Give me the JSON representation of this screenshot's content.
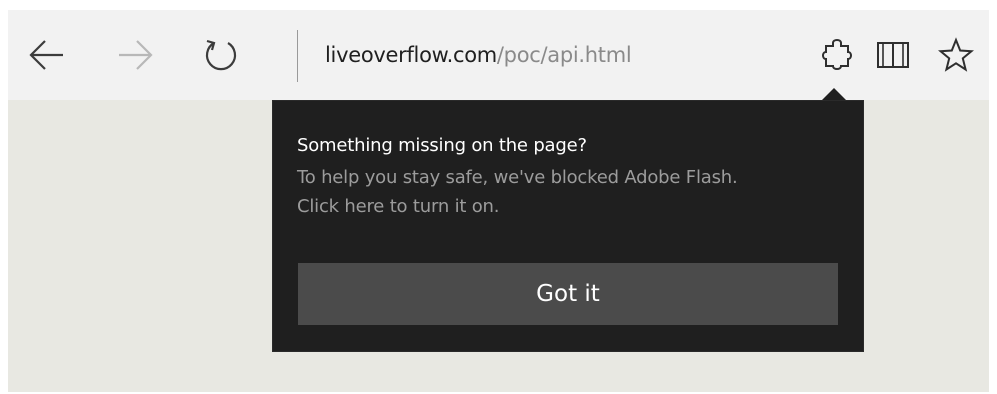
{
  "browser": {
    "nav": {
      "back_icon": "arrow-left-icon",
      "forward_icon": "arrow-right-icon",
      "refresh_icon": "refresh-icon"
    },
    "address": {
      "host": "liveoverflow.com",
      "path": "/poc/api.html"
    },
    "actions": {
      "extension_icon": "puzzle-piece-icon",
      "reading_view_icon": "book-icon",
      "favorites_icon": "star-icon"
    }
  },
  "popup": {
    "title": "Something missing on the page?",
    "body_line1": "To help you stay safe, we've blocked Adobe Flash.",
    "body_line2": "Click here to turn it on.",
    "button_label": "Got it"
  },
  "colors": {
    "toolbar_bg": "#f2f2f2",
    "page_bg": "#e8e8e2",
    "popup_bg": "#1f1f1f",
    "button_bg": "#4b4b4b",
    "muted_text": "#9c9c9c"
  }
}
